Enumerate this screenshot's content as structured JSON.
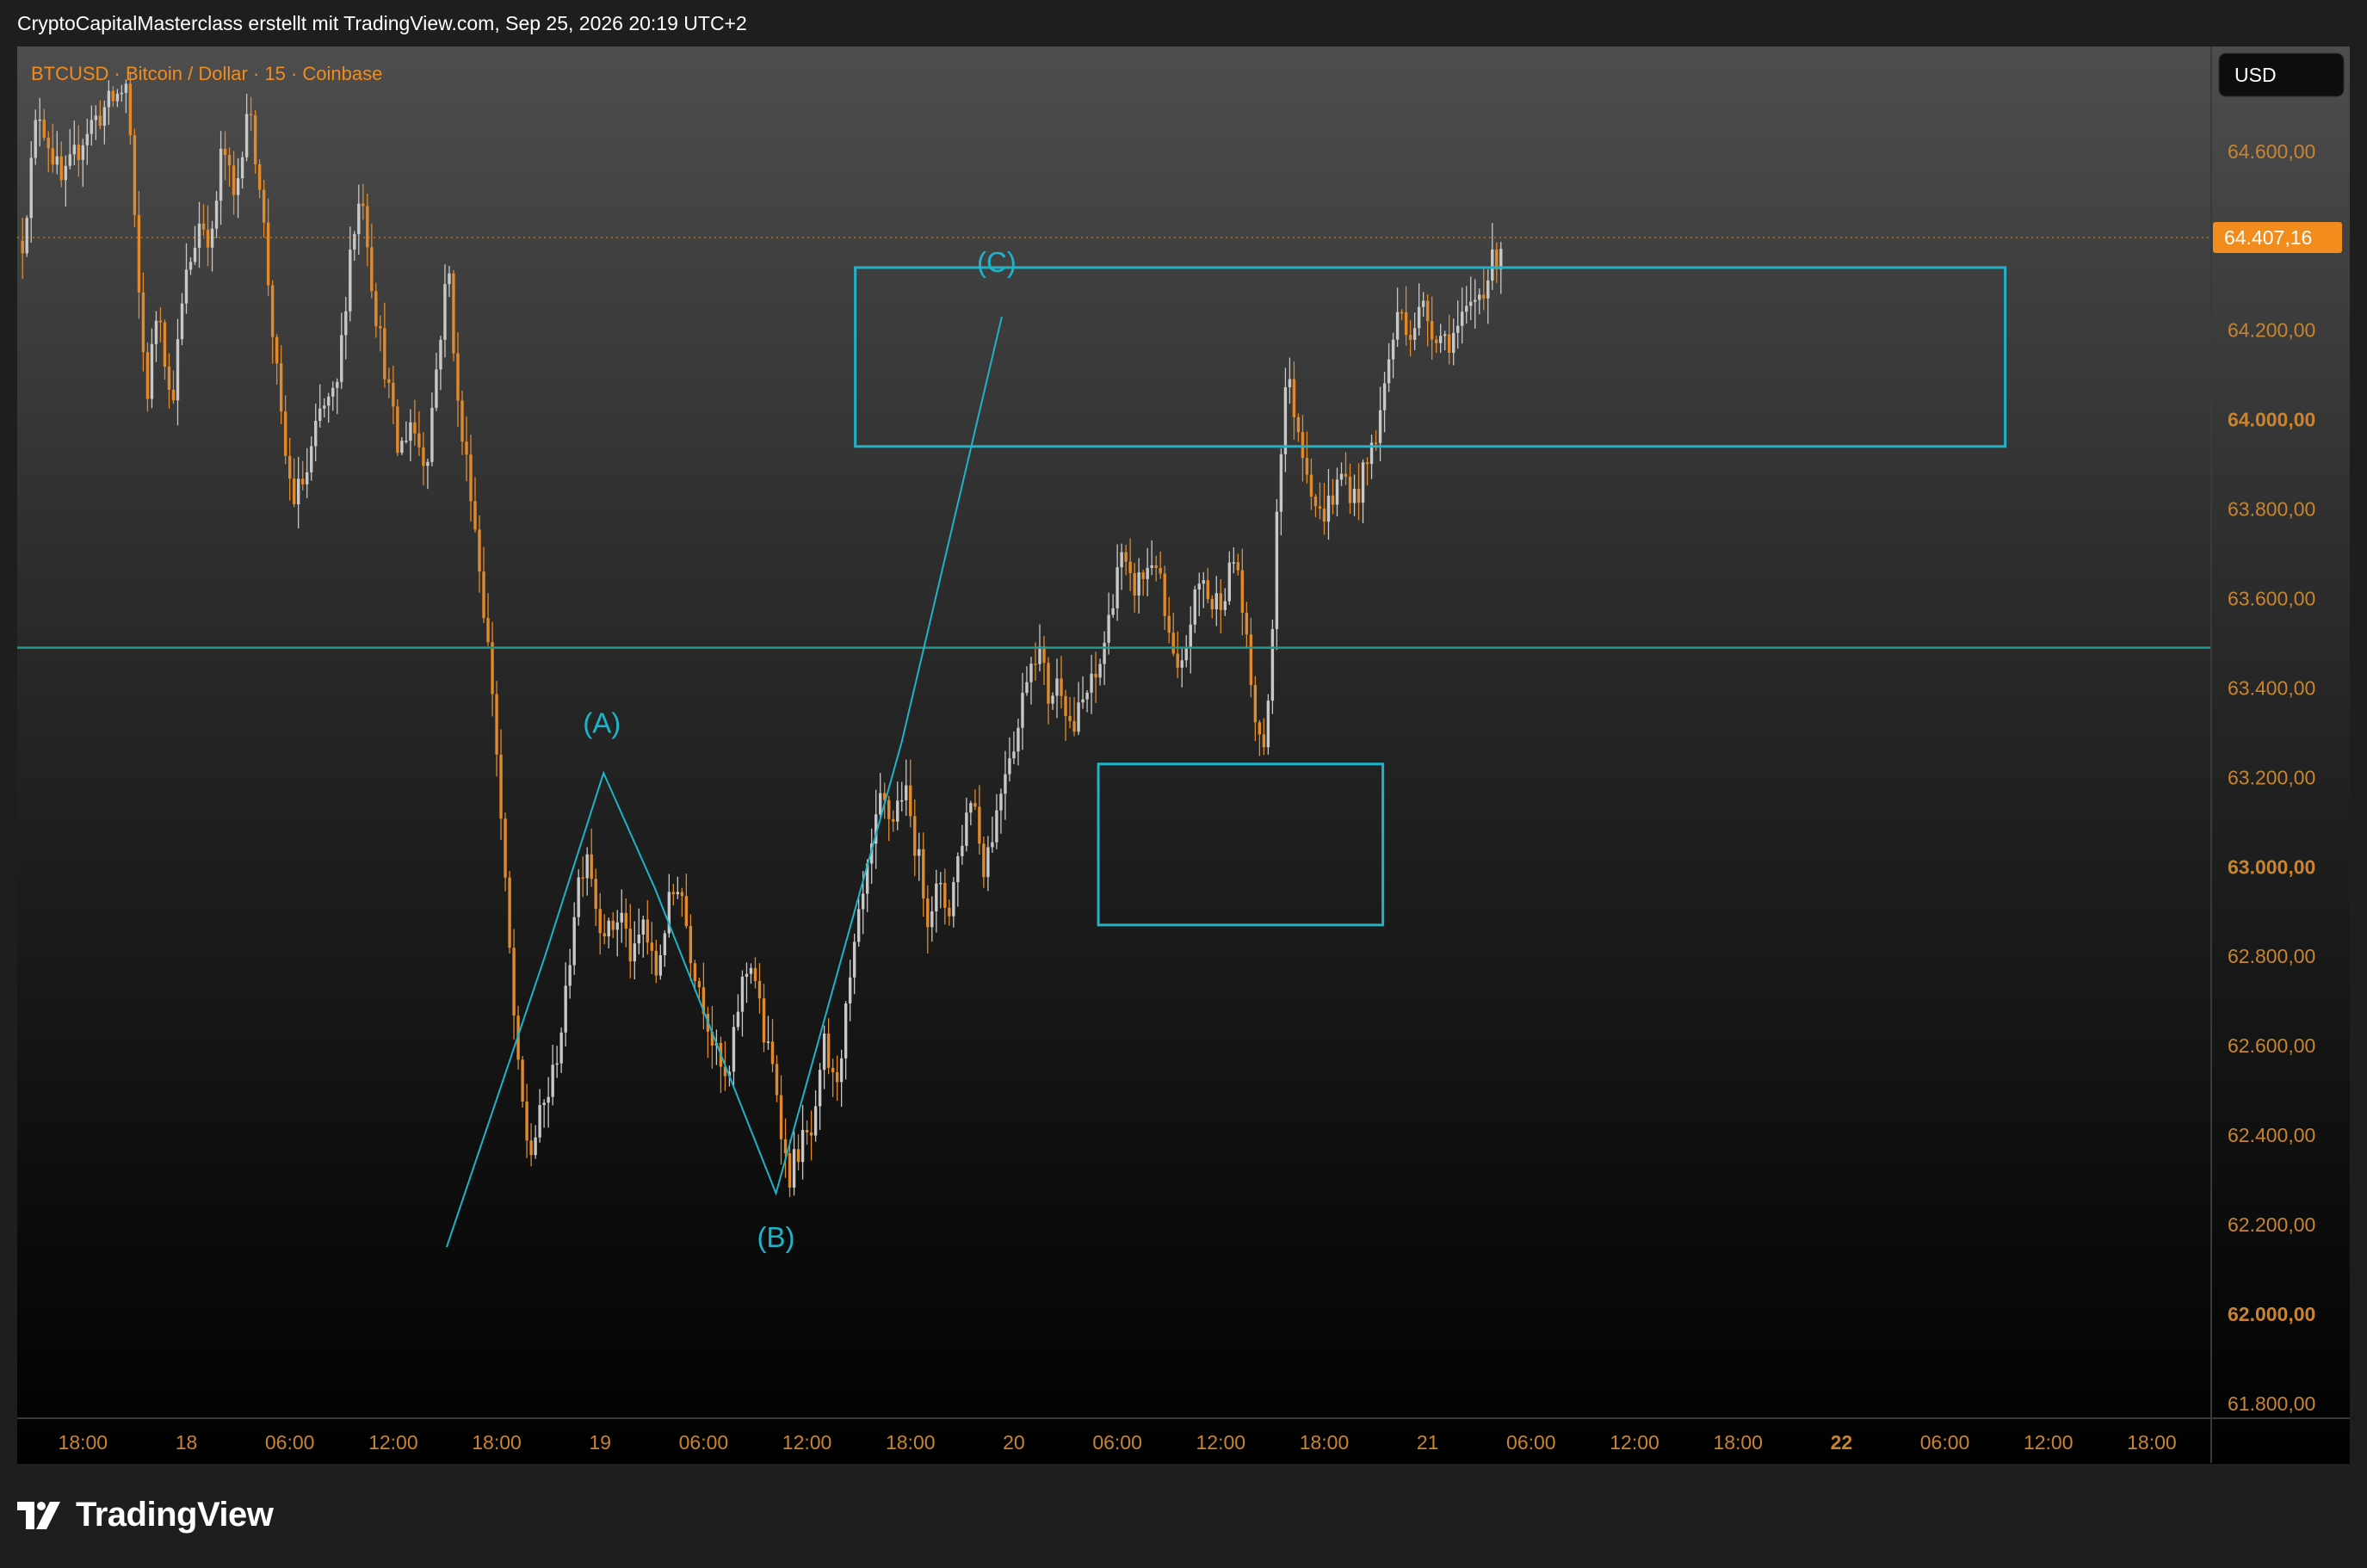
{
  "header": {
    "attribution": "CryptoCapitalMasterclass erstellt mit TradingView.com, Sep 25, 2026 20:19 UTC+2"
  },
  "footer": {
    "brand": "TradingView"
  },
  "colors": {
    "up": "#c8c8c8",
    "down": "#e08a2c",
    "accent_orange": "#f28c1d",
    "wave": "#1fb3c9",
    "level_line": "#1e9c8f",
    "axis_text": "#c8842e"
  },
  "icons": [
    "tradingview-logo-icon"
  ],
  "chart_data": {
    "type": "candlestick",
    "title": "BTCUSD · Bitcoin / Dollar · 15 · Coinbase",
    "currency_label": "USD",
    "current_price": "64.407,16",
    "current_price_value": 64407.16,
    "ylim": [
      61720,
      64750
    ],
    "y_ticks": [
      {
        "value": 64600,
        "label": "64.600,00",
        "bold": false
      },
      {
        "value": 64200,
        "label": "64.200,00",
        "bold": false
      },
      {
        "value": 64000,
        "label": "64.000,00",
        "bold": true
      },
      {
        "value": 63800,
        "label": "63.800,00",
        "bold": false
      },
      {
        "value": 63600,
        "label": "63.600,00",
        "bold": false
      },
      {
        "value": 63400,
        "label": "63.400,00",
        "bold": false
      },
      {
        "value": 63200,
        "label": "63.200,00",
        "bold": false
      },
      {
        "value": 63000,
        "label": "63.000,00",
        "bold": true
      },
      {
        "value": 62800,
        "label": "62.800,00",
        "bold": false
      },
      {
        "value": 62600,
        "label": "62.600,00",
        "bold": false
      },
      {
        "value": 62400,
        "label": "62.400,00",
        "bold": false
      },
      {
        "value": 62200,
        "label": "62.200,00",
        "bold": false
      },
      {
        "value": 62000,
        "label": "62.000,00",
        "bold": true
      },
      {
        "value": 61800,
        "label": "61.800,00",
        "bold": false
      }
    ],
    "x_ticks": [
      {
        "t": -6,
        "label": "18:00",
        "bold": false
      },
      {
        "t": 0,
        "label": "18",
        "bold": false
      },
      {
        "t": 6,
        "label": "06:00",
        "bold": false
      },
      {
        "t": 12,
        "label": "12:00",
        "bold": false
      },
      {
        "t": 18,
        "label": "18:00",
        "bold": false
      },
      {
        "t": 24,
        "label": "19",
        "bold": false
      },
      {
        "t": 30,
        "label": "06:00",
        "bold": false
      },
      {
        "t": 36,
        "label": "12:00",
        "bold": false
      },
      {
        "t": 42,
        "label": "18:00",
        "bold": false
      },
      {
        "t": 48,
        "label": "20",
        "bold": false
      },
      {
        "t": 54,
        "label": "06:00",
        "bold": false
      },
      {
        "t": 60,
        "label": "12:00",
        "bold": false
      },
      {
        "t": 66,
        "label": "18:00",
        "bold": false
      },
      {
        "t": 72,
        "label": "21",
        "bold": false
      },
      {
        "t": 78,
        "label": "06:00",
        "bold": false
      },
      {
        "t": 84,
        "label": "12:00",
        "bold": false
      },
      {
        "t": 90,
        "label": "18:00",
        "bold": false
      },
      {
        "t": 96,
        "label": "22",
        "bold": true
      },
      {
        "t": 102,
        "label": "06:00",
        "bold": false
      },
      {
        "t": 108,
        "label": "12:00",
        "bold": false
      },
      {
        "t": 114,
        "label": "18:00",
        "bold": false
      }
    ],
    "price_path": [
      [
        -9.5,
        64400
      ],
      [
        -8.6,
        64700
      ],
      [
        -7.2,
        64520
      ],
      [
        -5.8,
        64650
      ],
      [
        -3.4,
        64750
      ],
      [
        -2.9,
        64350
      ],
      [
        -2.3,
        64050
      ],
      [
        -1.6,
        64280
      ],
      [
        -0.9,
        64020
      ],
      [
        -0.1,
        64300
      ],
      [
        0.8,
        64450
      ],
      [
        1.5,
        64400
      ],
      [
        2.1,
        64620
      ],
      [
        2.8,
        64480
      ],
      [
        3.5,
        64700
      ],
      [
        4.2,
        64560
      ],
      [
        5.0,
        64200
      ],
      [
        5.6,
        63950
      ],
      [
        6.2,
        63820
      ],
      [
        7.0,
        63880
      ],
      [
        7.8,
        64020
      ],
      [
        8.7,
        64050
      ],
      [
        9.5,
        64380
      ],
      [
        10.2,
        64520
      ],
      [
        10.9,
        64260
      ],
      [
        11.6,
        64100
      ],
      [
        12.3,
        63920
      ],
      [
        13.0,
        64000
      ],
      [
        13.9,
        63900
      ],
      [
        14.6,
        64150
      ],
      [
        15.2,
        64350
      ],
      [
        15.8,
        64000
      ],
      [
        16.5,
        63850
      ],
      [
        17.2,
        63600
      ],
      [
        17.8,
        63380
      ],
      [
        18.5,
        62950
      ],
      [
        19.2,
        62550
      ],
      [
        19.9,
        62350
      ],
      [
        20.6,
        62450
      ],
      [
        21.2,
        62520
      ],
      [
        22.0,
        62700
      ],
      [
        22.6,
        62950
      ],
      [
        23.3,
        63050
      ],
      [
        23.8,
        62900
      ],
      [
        24.5,
        62850
      ],
      [
        25.2,
        62900
      ],
      [
        25.9,
        62780
      ],
      [
        26.5,
        62880
      ],
      [
        27.2,
        62750
      ],
      [
        27.9,
        62900
      ],
      [
        28.6,
        62980
      ],
      [
        29.2,
        62820
      ],
      [
        30.0,
        62700
      ],
      [
        30.7,
        62580
      ],
      [
        31.4,
        62500
      ],
      [
        32.1,
        62720
      ],
      [
        32.8,
        62800
      ],
      [
        33.5,
        62620
      ],
      [
        34.2,
        62520
      ],
      [
        34.9,
        62300
      ],
      [
        35.6,
        62380
      ],
      [
        36.4,
        62400
      ],
      [
        37.0,
        62600
      ],
      [
        37.6,
        62500
      ],
      [
        38.2,
        62650
      ],
      [
        38.9,
        62850
      ],
      [
        39.6,
        63000
      ],
      [
        40.3,
        63150
      ],
      [
        40.9,
        63100
      ],
      [
        41.6,
        63180
      ],
      [
        42.3,
        63050
      ],
      [
        43.0,
        62900
      ],
      [
        43.6,
        62950
      ],
      [
        44.2,
        62900
      ],
      [
        44.9,
        63050
      ],
      [
        45.6,
        63180
      ],
      [
        46.2,
        63000
      ],
      [
        46.9,
        63100
      ],
      [
        47.6,
        63250
      ],
      [
        48.2,
        63300
      ],
      [
        48.8,
        63450
      ],
      [
        49.4,
        63500
      ],
      [
        50.0,
        63380
      ],
      [
        50.7,
        63420
      ],
      [
        51.4,
        63300
      ],
      [
        52.1,
        63380
      ],
      [
        52.8,
        63420
      ],
      [
        53.5,
        63550
      ],
      [
        54.1,
        63700
      ],
      [
        54.8,
        63620
      ],
      [
        55.5,
        63650
      ],
      [
        56.2,
        63700
      ],
      [
        56.9,
        63520
      ],
      [
        57.6,
        63400
      ],
      [
        58.2,
        63550
      ],
      [
        58.9,
        63650
      ],
      [
        59.5,
        63580
      ],
      [
        60.2,
        63620
      ],
      [
        60.9,
        63700
      ],
      [
        61.6,
        63450
      ],
      [
        62.3,
        63250
      ],
      [
        62.8,
        63350
      ],
      [
        63.3,
        63850
      ],
      [
        63.8,
        64100
      ],
      [
        64.4,
        64000
      ],
      [
        65.0,
        63900
      ],
      [
        65.7,
        63780
      ],
      [
        66.4,
        63820
      ],
      [
        67.1,
        63880
      ],
      [
        67.8,
        63820
      ],
      [
        68.5,
        63900
      ],
      [
        69.2,
        64000
      ],
      [
        69.8,
        64150
      ],
      [
        70.4,
        64250
      ],
      [
        71.0,
        64200
      ],
      [
        71.7,
        64250
      ],
      [
        72.4,
        64200
      ],
      [
        73.1,
        64180
      ],
      [
        73.8,
        64200
      ],
      [
        74.5,
        64250
      ],
      [
        75.2,
        64300
      ],
      [
        75.8,
        64350
      ],
      [
        76.4,
        64407
      ]
    ],
    "annotations": {
      "wave_path": [
        {
          "t": 15.1,
          "p": 62150
        },
        {
          "t": 20.8,
          "p": 62800
        },
        {
          "t": 24.2,
          "p": 63210
        },
        {
          "t": 27.2,
          "p": 62950
        },
        {
          "t": 34.2,
          "p": 62270
        },
        {
          "t": 41.5,
          "p": 63280
        },
        {
          "t": 47.3,
          "p": 64230
        }
      ],
      "wave_labels": [
        {
          "text": "(A)",
          "t": 24.1,
          "p": 63300
        },
        {
          "text": "(B)",
          "t": 34.2,
          "p": 62150
        },
        {
          "text": "(C)",
          "t": 47.0,
          "p": 64330
        }
      ],
      "zones": [
        {
          "t0": 38.8,
          "t1": 105.5,
          "p_top": 64340,
          "p_bot": 63940
        },
        {
          "t0": 52.9,
          "t1": 69.4,
          "p_top": 63230,
          "p_bot": 62870
        }
      ],
      "horizontal_level": 63490
    }
  }
}
